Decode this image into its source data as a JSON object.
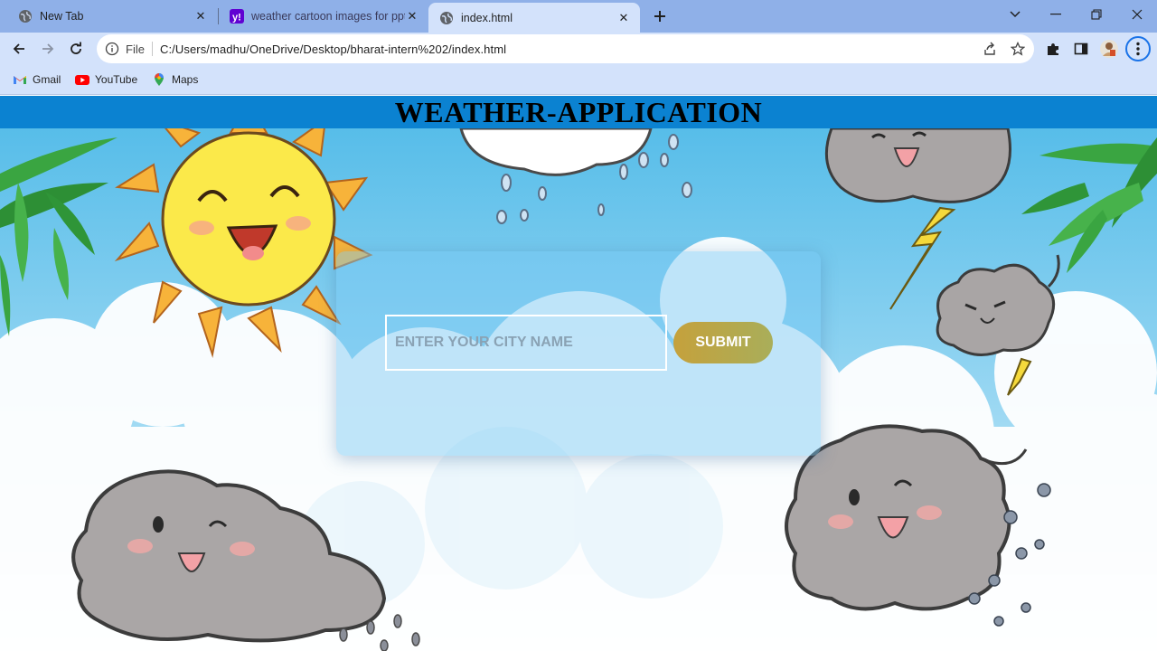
{
  "browser": {
    "tabs": [
      {
        "title": "New Tab",
        "icon": "globe-icon"
      },
      {
        "title": "weather cartoon images for ppt",
        "icon": "yahoo-icon"
      },
      {
        "title": "index.html",
        "icon": "globe-icon"
      }
    ],
    "address": {
      "scheme_label": "File",
      "url": "C:/Users/madhu/OneDrive/Desktop/bharat-intern%202/index.html"
    },
    "bookmarks": [
      {
        "label": "Gmail",
        "icon": "gmail-icon"
      },
      {
        "label": "YouTube",
        "icon": "youtube-icon"
      },
      {
        "label": "Maps",
        "icon": "maps-icon"
      }
    ]
  },
  "page": {
    "heading": "WEATHER-APPLICATION",
    "city_input": {
      "placeholder": "ENTER YOUR CITY NAME",
      "value": ""
    },
    "submit_label": "SUBMIT"
  },
  "colors": {
    "header_bar": "#0b82d1",
    "tab_strip": "#8fb0e8",
    "toolbar": "#d3e2fb",
    "sky": "#6fc6ef",
    "submit_gradient_start": "#c5a13c",
    "submit_gradient_end": "#a9ae5a"
  }
}
